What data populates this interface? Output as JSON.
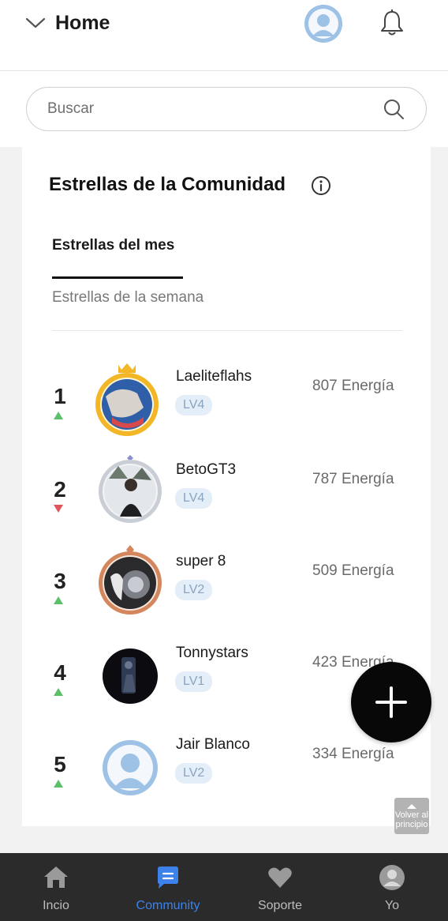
{
  "header": {
    "title": "Home"
  },
  "search": {
    "placeholder": "Buscar"
  },
  "section": {
    "title": "Estrellas de la Comunidad",
    "tabs": [
      {
        "label": "Estrellas del mes",
        "active": true
      },
      {
        "label": "Estrellas de la semana",
        "active": false
      }
    ]
  },
  "ranking": [
    {
      "rank": "1",
      "trend": "up",
      "name": "Laeliteflahs",
      "level": "LV4",
      "energy": "807 Energía",
      "badge": "gold"
    },
    {
      "rank": "2",
      "trend": "down",
      "name": "BetoGT3",
      "level": "LV4",
      "energy": "787 Energía",
      "badge": "silver"
    },
    {
      "rank": "3",
      "trend": "up",
      "name": "super 8",
      "level": "LV2",
      "energy": "509 Energía",
      "badge": "bronze"
    },
    {
      "rank": "4",
      "trend": "up",
      "name": "Tonnystars",
      "level": "LV1",
      "energy": "423 Energía",
      "badge": "none"
    },
    {
      "rank": "5",
      "trend": "up",
      "name": "Jair Blanco",
      "level": "LV2",
      "energy": "334 Energía",
      "badge": "none"
    }
  ],
  "back_to_top": {
    "label": "Volver al principio"
  },
  "bottom_nav": [
    {
      "label": "Incio",
      "icon": "home-icon",
      "active": false
    },
    {
      "label": "Community",
      "icon": "chat-icon",
      "active": true
    },
    {
      "label": "Soporte",
      "icon": "heart-icon",
      "active": false
    },
    {
      "label": "Yo",
      "icon": "profile-icon",
      "active": false
    }
  ],
  "colors": {
    "accent": "#3d82ea",
    "trend_up": "#5cc06a",
    "trend_down": "#e0555c",
    "gold": "#f2b627",
    "silver": "#c9ced6",
    "bronze": "#d4865d"
  }
}
